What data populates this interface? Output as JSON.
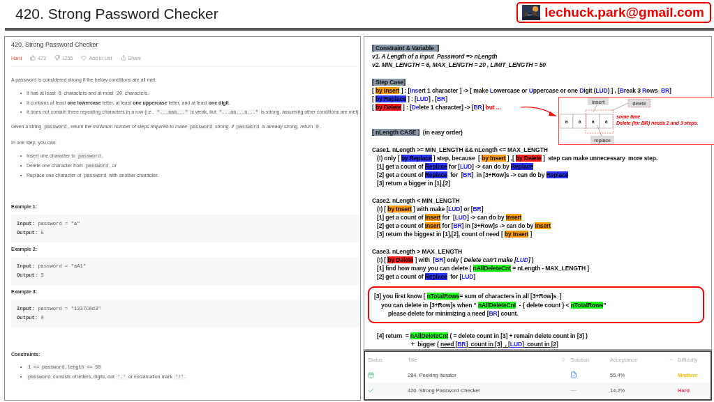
{
  "header": {
    "title": "420. Strong Password Checker",
    "email": "lechuck.park@gmail.com"
  },
  "problem": {
    "title": "420. Strong Password Checker",
    "difficulty": "Hard",
    "likes": "473",
    "dislikes": "1255",
    "add_to_list": "Add to List",
    "share": "Share",
    "intro": "A password is considered strong if the below conditions are all met:",
    "conditions": [
      [
        {
          "kind": "text",
          "text": "It has at least "
        },
        {
          "kind": "code",
          "text": "6"
        },
        {
          "kind": "text",
          "text": " characters and at most "
        },
        {
          "kind": "code",
          "text": "20"
        },
        {
          "kind": "text",
          "text": " characters."
        }
      ],
      [
        {
          "kind": "text",
          "text": "It contains at least "
        },
        {
          "kind": "bold",
          "text": "one lowercase"
        },
        {
          "kind": "text",
          "text": " letter, at least "
        },
        {
          "kind": "bold",
          "text": "one uppercase"
        },
        {
          "kind": "text",
          "text": " letter, and at least "
        },
        {
          "kind": "bold",
          "text": "one digit"
        },
        {
          "kind": "text",
          "text": "."
        }
      ],
      [
        {
          "kind": "text",
          "text": "It does not contain three repeating characters in a row (i.e., "
        },
        {
          "kind": "code",
          "text": "\"...aaa...\""
        },
        {
          "kind": "text",
          "text": " is weak, but "
        },
        {
          "kind": "code",
          "text": "\"...aa...a...\""
        },
        {
          "kind": "text",
          "text": " is strong, assuming other conditions are met)."
        }
      ]
    ],
    "task": [
      {
        "kind": "text",
        "text": "Given a string "
      },
      {
        "kind": "code",
        "text": "password"
      },
      {
        "kind": "text",
        "text": ", return "
      },
      {
        "kind": "italic",
        "text": "the minimum number of steps required to make "
      },
      {
        "kind": "code",
        "text": "password"
      },
      {
        "kind": "italic",
        "text": " strong. if "
      },
      {
        "kind": "code",
        "text": "password"
      },
      {
        "kind": "italic",
        "text": " is already strong, return "
      },
      {
        "kind": "code",
        "text": "0"
      },
      {
        "kind": "text",
        "text": "."
      }
    ],
    "step_intro": "In one step, you can:",
    "steps": [
      [
        {
          "kind": "text",
          "text": "Insert one character to "
        },
        {
          "kind": "code",
          "text": "password"
        },
        {
          "kind": "text",
          "text": ","
        }
      ],
      [
        {
          "kind": "text",
          "text": "Delete one character from "
        },
        {
          "kind": "code",
          "text": "password"
        },
        {
          "kind": "text",
          "text": ", or"
        }
      ],
      [
        {
          "kind": "text",
          "text": "Replace one character of "
        },
        {
          "kind": "code",
          "text": "password"
        },
        {
          "kind": "text",
          "text": " with another character."
        }
      ]
    ],
    "examples": [
      {
        "title": "Example 1:",
        "input_label": "Input:",
        "input": "password = \"a\"",
        "output_label": "Output:",
        "output": "5"
      },
      {
        "title": "Example 2:",
        "input_label": "Input:",
        "input": "password = \"aA1\"",
        "output_label": "Output:",
        "output": "3"
      },
      {
        "title": "Example 3:",
        "input_label": "Input:",
        "input": "password = \"1337C0d3\"",
        "output_label": "Output:",
        "output": "0"
      }
    ],
    "constraints_title": "Constraints:",
    "constraints": [
      [
        {
          "kind": "code",
          "text": "1 <= password.length <= 50"
        }
      ],
      [
        {
          "kind": "code",
          "text": "password"
        },
        {
          "kind": "text",
          "text": " consists of letters, digits, dot "
        },
        {
          "kind": "code",
          "text": "'.'"
        },
        {
          "kind": "text",
          "text": " or exclamation mark "
        },
        {
          "kind": "code",
          "text": "'!'"
        },
        {
          "kind": "text",
          "text": "."
        }
      ]
    ]
  },
  "notes": {
    "blocks": [
      {
        "framed": false,
        "lines": [
          {
            "kind": "top",
            "segs": [
              {
                "kind": "label",
                "text": "[ Constraint & Variable  ]"
              }
            ]
          },
          {
            "kind": "top",
            "segs": [
              {
                "kind": "italic",
                "text": "v1. A Length of a input  Password => nLength"
              }
            ]
          },
          {
            "kind": "top",
            "segs": [
              {
                "kind": "italic",
                "text": "v2. MIN_LENGTH = 6, MAX_LENGTH = 20 , LIMIT_LENGTH = 50"
              }
            ]
          }
        ]
      },
      {
        "framed": false,
        "lines": [
          {
            "kind": "top",
            "segs": [
              {
                "kind": "label",
                "text": "[ Step Case]"
              }
            ]
          },
          {
            "kind": "top",
            "segs": [
              {
                "kind": "text",
                "text": "[ "
              },
              {
                "kind": "orange",
                "text": "by Insert"
              },
              {
                "kind": "text",
                "text": " ] : ["
              },
              {
                "kind": "blue",
                "text": "Ins"
              },
              {
                "kind": "text",
                "text": "ert 1 character ] -> [ make "
              },
              {
                "kind": "blue",
                "text": "L"
              },
              {
                "kind": "text",
                "text": "owercase or "
              },
              {
                "kind": "blue",
                "text": "U"
              },
              {
                "kind": "text",
                "text": "ppercase or one "
              },
              {
                "kind": "blue",
                "text": "D"
              },
              {
                "kind": "text",
                "text": "igit ("
              },
              {
                "kind": "blue",
                "text": "LUD"
              },
              {
                "kind": "text",
                "text": ") ] , ["
              },
              {
                "kind": "blue",
                "text": "B"
              },
              {
                "kind": "text",
                "text": "reak 3 "
              },
              {
                "kind": "blue",
                "text": "R"
              },
              {
                "kind": "text",
                "text": "ows_"
              },
              {
                "kind": "blue",
                "text": "BR"
              },
              {
                "kind": "text",
                "text": "]"
              }
            ]
          },
          {
            "kind": "top",
            "segs": [
              {
                "kind": "text",
                "text": "[ "
              },
              {
                "kind": "bluebg",
                "text": "by Replace"
              },
              {
                "kind": "text",
                "text": " ] : ["
              },
              {
                "kind": "blue",
                "text": "LUD"
              },
              {
                "kind": "text",
                "text": "] , ["
              },
              {
                "kind": "blue",
                "text": "BR"
              },
              {
                "kind": "text",
                "text": "]"
              }
            ]
          },
          {
            "kind": "top",
            "segs": [
              {
                "kind": "text",
                "text": "[ "
              },
              {
                "kind": "redbg",
                "text": "by Delete"
              },
              {
                "kind": "text",
                "text": " ] : ["
              },
              {
                "kind": "blue",
                "text": "De"
              },
              {
                "kind": "text",
                "text": "lete 1 character] -> ["
              },
              {
                "kind": "blue",
                "text": "BR"
              },
              {
                "kind": "text",
                "text": "] "
              },
              {
                "kind": "red",
                "text": "but ..."
              }
            ]
          }
        ]
      },
      {
        "framed": false,
        "lines": [
          {
            "kind": "top",
            "segs": [
              {
                "kind": "label",
                "text": "[ nLength CASE ]"
              },
              {
                "kind": "text",
                "text": "  (in easy order)"
              }
            ]
          }
        ]
      },
      {
        "framed": false,
        "lines": [
          {
            "kind": "top",
            "segs": [
              {
                "kind": "text",
                "text": "Case1. nLength >= MIN_LENGTH && nLength <= MAX_LENGTH"
              }
            ]
          },
          {
            "kind": "item",
            "segs": [
              {
                "kind": "text",
                "text": "(!) only [ "
              },
              {
                "kind": "bluebg",
                "text": "by Replace"
              },
              {
                "kind": "text",
                "text": " ] step, because  [ "
              },
              {
                "kind": "orange",
                "text": "by Insert"
              },
              {
                "kind": "text",
                "text": " ] ,[ "
              },
              {
                "kind": "redbg",
                "text": "by Delete"
              },
              {
                "kind": "text",
                "text": " ]  step can make unnecessary  more step."
              }
            ]
          },
          {
            "kind": "item",
            "segs": [
              {
                "kind": "text",
                "text": "[1] get a count of "
              },
              {
                "kind": "bluebg",
                "text": "Replace"
              },
              {
                "kind": "text",
                "text": " for ["
              },
              {
                "kind": "blue",
                "text": "LUD"
              },
              {
                "kind": "text",
                "text": "] -> can do by "
              },
              {
                "kind": "bluebg",
                "text": "Replace"
              }
            ]
          },
          {
            "kind": "item",
            "segs": [
              {
                "kind": "text",
                "text": "[2] get a count of "
              },
              {
                "kind": "bluebg",
                "text": "Replace"
              },
              {
                "kind": "text",
                "text": "  for  ["
              },
              {
                "kind": "blue",
                "text": "BR"
              },
              {
                "kind": "text",
                "text": "]  in [3+Row]s -> can do by "
              },
              {
                "kind": "bluebg",
                "text": "Replace"
              }
            ]
          },
          {
            "kind": "item",
            "segs": [
              {
                "kind": "text",
                "text": "[3] return a bigger in [1],[2]"
              }
            ]
          }
        ]
      },
      {
        "framed": false,
        "lines": [
          {
            "kind": "top",
            "segs": [
              {
                "kind": "text",
                "text": "Case2. nLength < MIN_LENGTH"
              }
            ]
          },
          {
            "kind": "item",
            "segs": [
              {
                "kind": "text",
                "text": "(!) [ "
              },
              {
                "kind": "orange",
                "text": "by Insert"
              },
              {
                "kind": "text",
                "text": " ] with make ["
              },
              {
                "kind": "blue",
                "text": "LUD"
              },
              {
                "kind": "text",
                "text": "] or ["
              },
              {
                "kind": "blue",
                "text": "BR"
              },
              {
                "kind": "text",
                "text": "]"
              }
            ]
          },
          {
            "kind": "item",
            "segs": [
              {
                "kind": "text",
                "text": "[1] get a count of "
              },
              {
                "kind": "orange",
                "text": "Insert"
              },
              {
                "kind": "text",
                "text": " for  ["
              },
              {
                "kind": "blue",
                "text": "LUD"
              },
              {
                "kind": "text",
                "text": "] -> can do by "
              },
              {
                "kind": "orange",
                "text": "Insert"
              }
            ]
          },
          {
            "kind": "item",
            "segs": [
              {
                "kind": "text",
                "text": "[2] get a count of "
              },
              {
                "kind": "orange",
                "text": "Insert"
              },
              {
                "kind": "text",
                "text": " for ["
              },
              {
                "kind": "blue",
                "text": "BR"
              },
              {
                "kind": "text",
                "text": "] in [3+Row]s -> can do by "
              },
              {
                "kind": "orange",
                "text": "Insert"
              }
            ]
          },
          {
            "kind": "item",
            "segs": [
              {
                "kind": "text",
                "text": "[3] return the biggest in [1],[2], count of need [ "
              },
              {
                "kind": "orange",
                "text": "by Insert"
              },
              {
                "kind": "text",
                "text": " ]"
              }
            ]
          }
        ]
      },
      {
        "framed": false,
        "lines": [
          {
            "kind": "top",
            "segs": [
              {
                "kind": "text",
                "text": "Case3. nLength > MAX_LENGTH"
              }
            ]
          },
          {
            "kind": "item",
            "segs": [
              {
                "kind": "text",
                "text": "(!) [ "
              },
              {
                "kind": "redbg",
                "text": "by Delete"
              },
              {
                "kind": "text",
                "text": " ] with  ["
              },
              {
                "kind": "blue",
                "text": "BR"
              },
              {
                "kind": "text",
                "text": "] only ( "
              },
              {
                "kind": "italic",
                "text": "Delete can’t make ["
              },
              {
                "kind": "italicblue",
                "text": "LUD"
              },
              {
                "kind": "italic",
                "text": "]"
              },
              {
                "kind": "text",
                "text": " )"
              }
            ]
          },
          {
            "kind": "item",
            "segs": [
              {
                "kind": "text",
                "text": "[1] find how many you can delete ( "
              },
              {
                "kind": "green",
                "text": "nAllDeleteCnt"
              },
              {
                "kind": "text",
                "text": " = nLength - MAX_LENGTH ]"
              }
            ]
          },
          {
            "kind": "item",
            "segs": [
              {
                "kind": "text",
                "text": "[2] get a count of "
              },
              {
                "kind": "bluebg",
                "text": "Replace"
              },
              {
                "kind": "text",
                "text": "  for ["
              },
              {
                "kind": "blue",
                "text": "LUD"
              },
              {
                "kind": "text",
                "text": "]"
              }
            ]
          }
        ]
      },
      {
        "framed": true,
        "lines": [
          {
            "kind": "item",
            "segs": [
              {
                "kind": "text",
                "text": "[3] you first know [ "
              },
              {
                "kind": "green",
                "text": "nTotalRows"
              },
              {
                "kind": "text",
                "text": "= sum of characters in all [3+Row]s  ]"
              }
            ]
          },
          {
            "kind": "sub",
            "segs": [
              {
                "kind": "text",
                "text": "you can delete in [3+Row]s when “ "
              },
              {
                "kind": "green",
                "text": "nAllDeleteCnt"
              },
              {
                "kind": "text",
                "text": "  - { delete count } < "
              },
              {
                "kind": "green",
                "text": "nTotalRows"
              },
              {
                "kind": "text",
                "text": "”"
              }
            ]
          },
          {
            "kind": "subsub",
            "segs": [
              {
                "kind": "text",
                "text": "please delete for minimizing a need ["
              },
              {
                "kind": "blue",
                "text": "BR"
              },
              {
                "kind": "text",
                "text": "] count."
              }
            ]
          }
        ]
      },
      {
        "framed": false,
        "lines": [
          {
            "kind": "item",
            "segs": [
              {
                "kind": "text",
                "text": "[4] return  = "
              },
              {
                "kind": "green",
                "text": "nAllDeleteCnt"
              },
              {
                "kind": "text",
                "text": " ( = delete count in [3] + remain delete count in [3] )"
              }
            ]
          },
          {
            "kind": "deep",
            "segs": [
              {
                "kind": "text",
                "text": "+  bigger ( "
              },
              {
                "kind": "under",
                "text": "need ["
              },
              {
                "kind": "underblue",
                "text": "BR"
              },
              {
                "kind": "under",
                "text": "]  count in [3]  , ["
              },
              {
                "kind": "underblue",
                "text": "LUD"
              },
              {
                "kind": "under",
                "text": "]  count in [2]"
              }
            ]
          }
        ]
      }
    ],
    "diagram": {
      "cells": [
        "a",
        "a",
        "a",
        "a"
      ],
      "insert": "insert",
      "delete": "delete",
      "replace": "replace",
      "note": [
        "some time",
        "Delete (for BR) needs 2 and 3 steps."
      ]
    }
  },
  "table": {
    "columns": [
      "Status",
      "Title",
      "Solution",
      "Acceptance",
      "Difficulty"
    ],
    "rows": [
      {
        "kind": "scheduled",
        "title": "284. Peeking Iterator",
        "solution": true,
        "acceptance": "55.4%",
        "difficulty": "Medium",
        "color": "#ffb800"
      },
      {
        "kind": "solved",
        "title": "420. Strong Password Checker",
        "solution": false,
        "acceptance": "14.2%",
        "difficulty": "Hard",
        "color": "#ff375f"
      }
    ]
  }
}
